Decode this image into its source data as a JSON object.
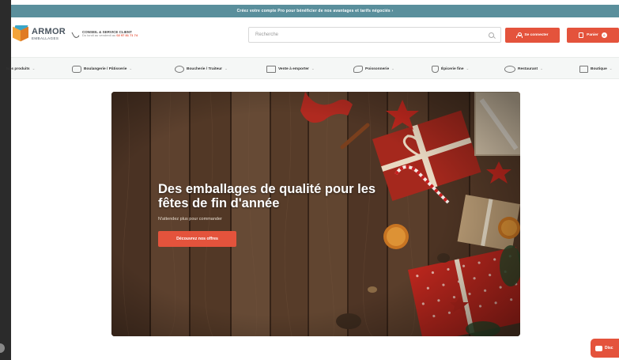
{
  "promo": {
    "text": "Créez votre compte Pro pour bénéficier de nos avantages et tarifs négociés ›"
  },
  "header": {
    "logo": {
      "line1": "ARMOR",
      "line2": "EMBALLAGES"
    },
    "service": {
      "title": "CONSEIL & SERVICE CLIENT",
      "subtitle": "Du lundi au vendredi au",
      "phone": "02 97 81 71 74"
    },
    "search": {
      "placeholder": "Recherche"
    },
    "login_label": "Se connecter",
    "cart_label": "Panier",
    "cart_count": "0"
  },
  "nav": {
    "items": [
      {
        "label": "Nos produits"
      },
      {
        "label": "Boulangerie / Pâtisserie"
      },
      {
        "label": "Boucherie / Traiteur"
      },
      {
        "label": "Vente à emporter"
      },
      {
        "label": "Poissonnerie"
      },
      {
        "label": "Épicerie fine"
      },
      {
        "label": "Restaurant"
      },
      {
        "label": "Boutique"
      }
    ]
  },
  "hero": {
    "title": "Des emballages de qualité pour les fêtes de fin d'année",
    "subtitle": "N'attendez plus pour commander",
    "cta": "Découvrez nos offres"
  },
  "chat": {
    "label": "Disc"
  },
  "colors": {
    "accent": "#e4533c",
    "promo_bar": "#5a8f9c",
    "nav_bg": "#f5f7f6"
  }
}
